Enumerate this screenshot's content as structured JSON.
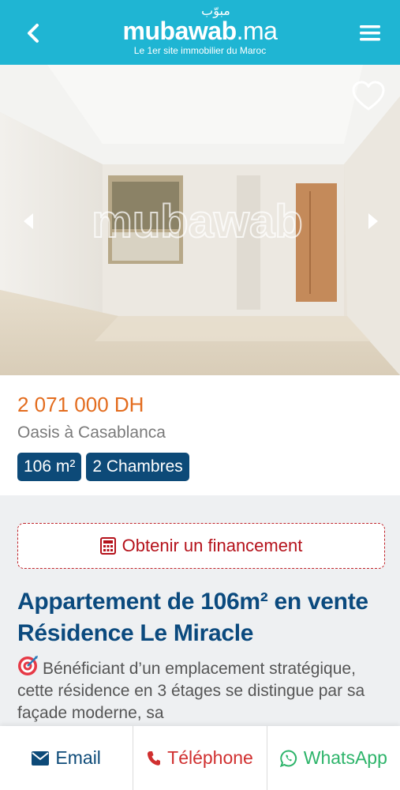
{
  "header": {
    "logo_arabic": "مبوّب",
    "logo_name": "mubawab",
    "logo_tld": ".ma",
    "tagline": "Le 1er site immobilier du Maroc"
  },
  "photo": {
    "watermark": "mubawab"
  },
  "listing": {
    "price": "2 071 000 DH",
    "location": "Oasis à Casablanca",
    "tags": [
      "106 m²",
      "2 Chambres"
    ]
  },
  "financing": {
    "label": "Obtenir un financement"
  },
  "title": "Appartement de 106m² en vente Résidence Le Miracle",
  "description": "Bénéficiant d’un emplacement stratégique, cette résidence en 3 étages se distingue par sa façade moderne, sa",
  "footer": {
    "email_label": "Email",
    "phone_label": "Téléphone",
    "whatsapp_label": "WhatsApp"
  },
  "colors": {
    "header_bg": "#1fb5d3",
    "price": "#e36c1e",
    "tag_bg": "#0d4a78",
    "financing": "#b5121b",
    "title": "#0b4a7e",
    "whatsapp": "#2db46a"
  }
}
